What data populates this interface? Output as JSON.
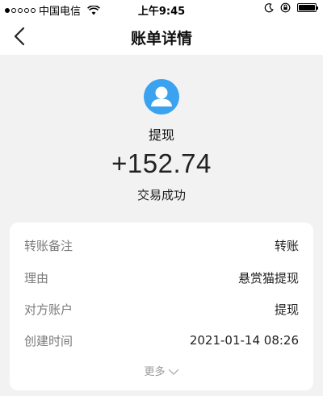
{
  "status_bar": {
    "carrier": "中国电信",
    "time": "上午9:45"
  },
  "nav": {
    "title": "账单详情"
  },
  "summary": {
    "name": "提现",
    "amount": "+152.74",
    "status": "交易成功"
  },
  "details": {
    "rows": [
      {
        "label": "转账备注",
        "value": "转账"
      },
      {
        "label": "理由",
        "value": "悬赏猫提现"
      },
      {
        "label": "对方账户",
        "value": "提现"
      },
      {
        "label": "创建时间",
        "value": "2021-01-14 08:26"
      }
    ],
    "more_label": "更多"
  },
  "colors": {
    "avatar_bg": "#3ba2ef",
    "page_bg": "#f2f2f2"
  }
}
